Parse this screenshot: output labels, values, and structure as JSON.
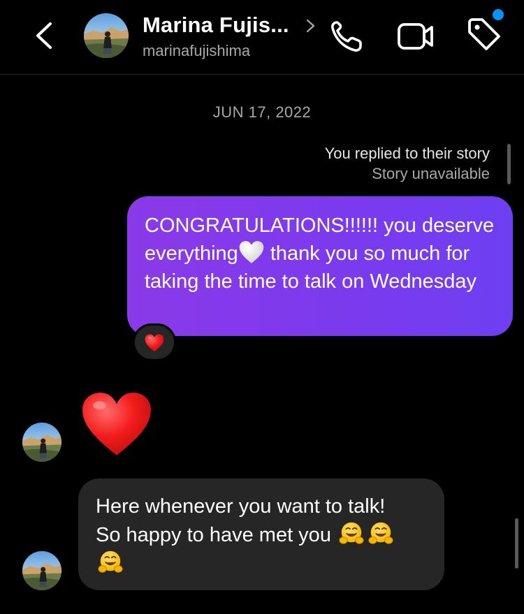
{
  "header": {
    "contact_name": "Marina Fujis...",
    "handle": "marinafujishima",
    "icons": [
      "back-chevron-icon",
      "chevron-right-icon",
      "phone-icon",
      "video-camera-icon",
      "tag-icon"
    ],
    "notification_dot_color": "#0095f6"
  },
  "thread": {
    "date_label": "JUN 17, 2022",
    "story_reply": {
      "title": "You replied to their story",
      "subtitle": "Story unavailable"
    },
    "sent_message": {
      "part1": "CONGRATULATIONS!!!!!! you deserve everything",
      "part2": " thank you so much for taking the time to talk on Wednesday",
      "emoji": "white-heart",
      "reaction": "red-heart"
    },
    "received_heart": "red-heart",
    "received_message": {
      "line1": "Here whenever you want to talk!",
      "line2": "So happy to have met you",
      "emoji": "hugging-face",
      "emoji_count": 3
    }
  },
  "colors": {
    "sent_bubble": "#7c3aed",
    "received_bubble": "#262626",
    "background": "#000000",
    "secondary_text": "#a8a8a8"
  }
}
